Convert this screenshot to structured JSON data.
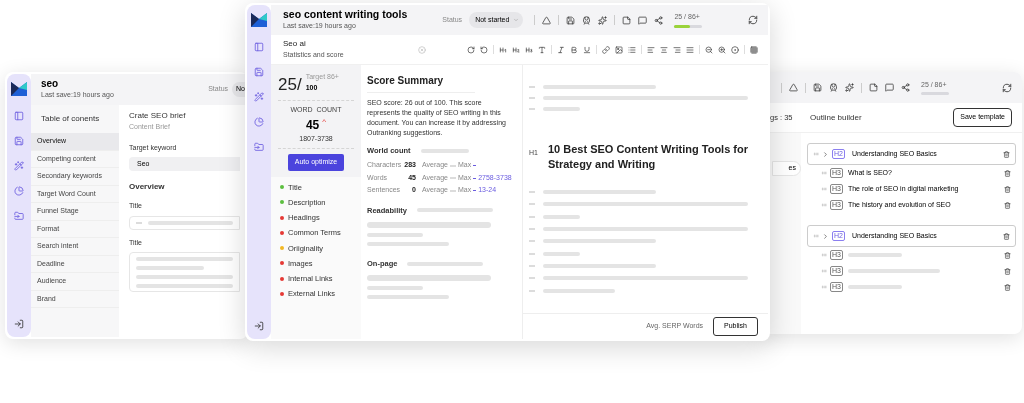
{
  "back_left": {
    "header": {
      "title": "seo",
      "subtitle": "Last save:19 hours ago",
      "status_label": "Status",
      "status_value": "No"
    },
    "toc": {
      "title": "Table of conents",
      "items": [
        {
          "label": "Overview",
          "selected": true
        },
        {
          "label": "Competing content",
          "selected": false
        },
        {
          "label": "Secondary keywords",
          "selected": false
        },
        {
          "label": "Target Word Count",
          "selected": false
        },
        {
          "label": "Funnel Stage",
          "selected": false
        },
        {
          "label": "Format",
          "selected": false
        },
        {
          "label": "Search intent",
          "selected": false
        },
        {
          "label": "Deadline",
          "selected": false
        },
        {
          "label": "Audience",
          "selected": false
        },
        {
          "label": "Brand",
          "selected": false
        }
      ]
    },
    "brief": {
      "title": "Crate SEO brief",
      "subtitle": "Content Brief",
      "keyword_label": "Target keyword",
      "keyword_value": "Seo",
      "section": "Overview",
      "fields": [
        {
          "label": "Title",
          "kind": "line"
        },
        {
          "label": "Title",
          "kind": "area"
        }
      ]
    }
  },
  "main": {
    "header": {
      "title": "seo content writing tools",
      "subtitle": "Last save:19 hours ago",
      "status_label": "Status",
      "status_value": "Not started",
      "score": "25 / 86+",
      "level": 0.55
    },
    "panel": {
      "title": "Seo ai",
      "subtitle": "Statistics and score"
    },
    "score": {
      "value": "25/",
      "target": "Target 86+",
      "max": "100",
      "word_count_label": "WORD  COUNT",
      "word_count": "45",
      "trend": "^",
      "range": "1807-3738",
      "button": "Auto optimize"
    },
    "checks": [
      {
        "label": "Title",
        "color": "#5cbf3f"
      },
      {
        "label": "Description",
        "color": "#5cbf3f"
      },
      {
        "label": "Headings",
        "color": "#e53935"
      },
      {
        "label": "Common Terms",
        "color": "#e53935"
      },
      {
        "label": "Oriiginality",
        "color": "#f2b824"
      },
      {
        "label": "Images",
        "color": "#e53935"
      },
      {
        "label": "Internal Links",
        "color": "#e53935"
      },
      {
        "label": "External Links",
        "color": "#e53935"
      }
    ],
    "summary": {
      "title": "Score Summary",
      "text": "SEO score: 26 out of 100. This score represents the quality of SEO writing in this document. You can increase it by addressing Outranking suggestions.",
      "world_count": {
        "title": "World count",
        "rows": [
          {
            "name": "Characters",
            "value": "283",
            "average": "Average",
            "max": "Max"
          },
          {
            "name": "Words",
            "value": "45",
            "average": "Average",
            "max": "Max",
            "range": "2758-3738"
          },
          {
            "name": "Sentences",
            "value": "0",
            "average": "Average",
            "max": "Max",
            "range": "13-24"
          }
        ]
      },
      "readability": "Readability",
      "onpage": "On-page"
    },
    "editor": {
      "heading_tag": "H1",
      "heading": "10 Best SEO Content Writing Tools for Strategy and Writing",
      "avg_label": "Avg. SERP Words",
      "publish": "Publish"
    }
  },
  "back_right": {
    "header": {
      "score": "25 / 86+"
    },
    "cut_text": "gs : 35",
    "pill": "es",
    "outline": {
      "title": "Outline builder",
      "save": "Save template",
      "groups": [
        {
          "tag": "H2",
          "title": "Understanding SEO Basics",
          "children": [
            {
              "tag": "H3",
              "kind": "text",
              "title": "What is SEO?"
            },
            {
              "tag": "H3",
              "kind": "text",
              "title": "The role of SEO in digital marketing"
            },
            {
              "tag": "H3",
              "kind": "text",
              "title": "The history and evolution of SEO"
            }
          ]
        },
        {
          "tag": "H2",
          "title": "Understanding SEO Basics",
          "children": [
            {
              "tag": "H3",
              "kind": "placeholder"
            },
            {
              "tag": "H3",
              "kind": "placeholder"
            },
            {
              "tag": "H3",
              "kind": "placeholder"
            }
          ]
        }
      ]
    }
  }
}
